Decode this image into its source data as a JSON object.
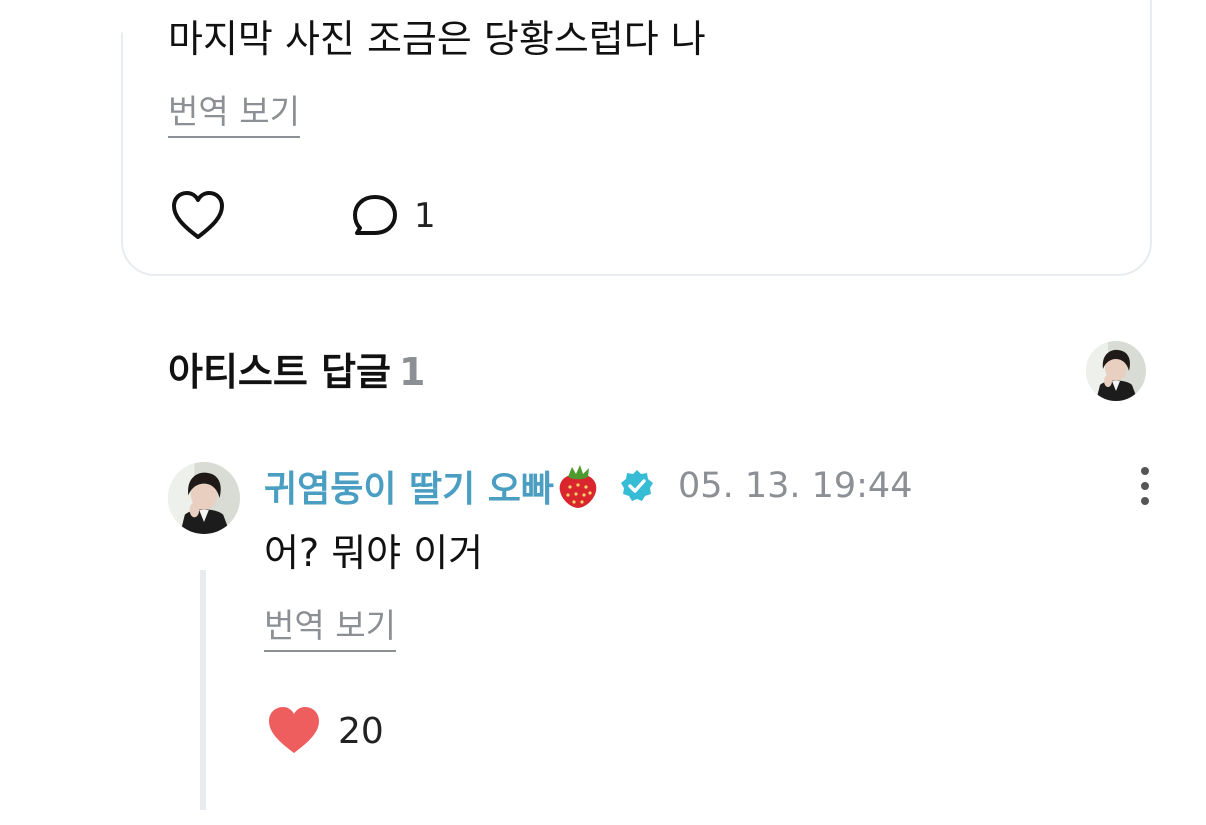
{
  "comment": {
    "text": "마지막 사진 조금은 당황스럽다 나",
    "translate_label": "번역 보기",
    "like_icon": "heart-outline-icon",
    "reply_icon": "speech-bubble-icon",
    "reply_count": "1"
  },
  "artist_replies": {
    "title": "아티스트 답글",
    "count": "1"
  },
  "reply": {
    "author": "귀염둥이 딸기 오빠",
    "author_emoji": "strawberry-icon",
    "verified_icon": "verified-badge-icon",
    "timestamp": "05. 13. 19:44",
    "text": "어? 뭐야 이거",
    "translate_label": "번역 보기",
    "like_icon": "heart-filled-icon",
    "like_count": "20",
    "more_icon": "more-vertical-icon"
  },
  "colors": {
    "author_name": "#4a9ec2",
    "verified_badge": "#36bcd4",
    "liked_heart": "#ef5e5e",
    "muted_text": "#8c8f94",
    "card_border": "#e8ebef",
    "thread_line": "#e9ebee"
  }
}
